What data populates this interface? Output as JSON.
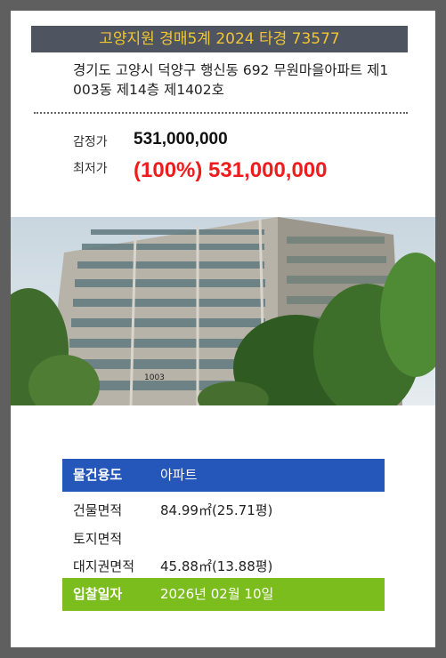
{
  "header": {
    "title": "고양지원 경매5계 2024 타경 73577"
  },
  "address": {
    "line1": "경기도 고양시 덕양구 행신동 692 무원마을아파트 제1",
    "line2": "003동 제14층 제1402호"
  },
  "prices": {
    "appraisal_label": "감정가",
    "appraisal_value": "531,000,000",
    "minimum_label": "최저가",
    "minimum_value": "(100%) 531,000,000"
  },
  "photo": {
    "building_number": "1003"
  },
  "details": {
    "type_label": "물건용도",
    "type_value": "아파트",
    "building_area_label": "건물면적",
    "building_area_value": "84.99㎡(25.71평)",
    "land_area_label": "토지면적",
    "land_area_value": "",
    "land_right_label": "대지권면적",
    "land_right_value": "45.88㎡(13.88평)",
    "bid_date_label": "입찰일자",
    "bid_date_value": "2026년 02월 10일"
  },
  "colors": {
    "background": "#5f5f5f",
    "header_bg": "#4e5560",
    "header_text": "#f2c531",
    "min_price": "#ee1d1d",
    "type_row_bg": "#2457b9",
    "date_row_bg": "#7cbd1e"
  }
}
